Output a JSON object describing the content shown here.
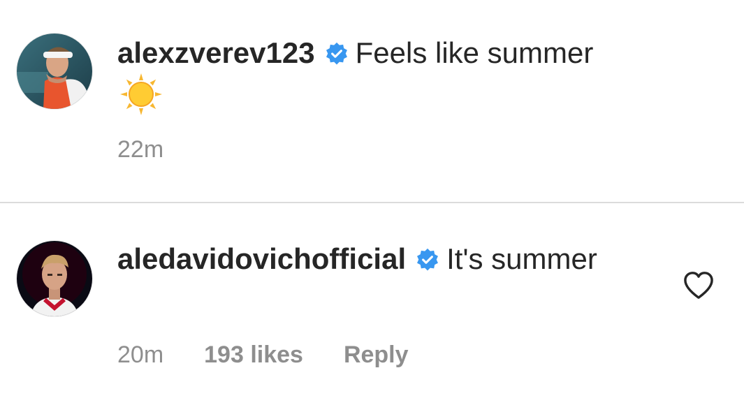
{
  "comments": [
    {
      "username": "alexzverev123",
      "verified_icon": "verified-badge-icon",
      "text": "Feels like summer",
      "emoji_icon": "sun-emoji-icon",
      "time": "22m"
    },
    {
      "username": "aledavidovichofficial",
      "verified_icon": "verified-badge-icon",
      "text": "It's summer",
      "time": "20m",
      "likes": "193 likes",
      "reply_label": "Reply",
      "like_icon": "heart-outline-icon"
    }
  ],
  "colors": {
    "verified_blue": "#3897f0",
    "meta_gray": "#8e8e8e",
    "divider": "#dbdbdb",
    "text": "#262626"
  }
}
